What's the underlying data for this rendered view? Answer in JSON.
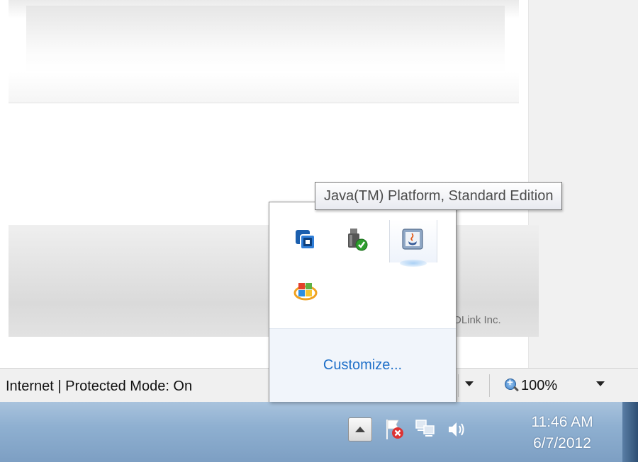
{
  "browser": {
    "footer_copyright": "DLink Inc.",
    "status": {
      "zone_text": "Internet | Protected Mode: On",
      "zoom_level": "100%"
    }
  },
  "tooltip": {
    "text": "Java(TM) Platform, Standard Edition"
  },
  "overflow_tray": {
    "icons": [
      "vmware-icon",
      "usb-safe-remove-icon",
      "java-icon",
      "windows-live-icon"
    ],
    "customize_label": "Customize..."
  },
  "taskbar": {
    "tray_icons": [
      "show-hidden-icons-button",
      "action-center-flag-icon",
      "network-icon",
      "volume-icon"
    ],
    "clock_time": "11:46 AM",
    "clock_date": "6/7/2012"
  },
  "colors": {
    "taskbar": "#8fb0d1",
    "link_blue": "#1e6fc8",
    "tooltip_text": "#4c4c4c"
  }
}
